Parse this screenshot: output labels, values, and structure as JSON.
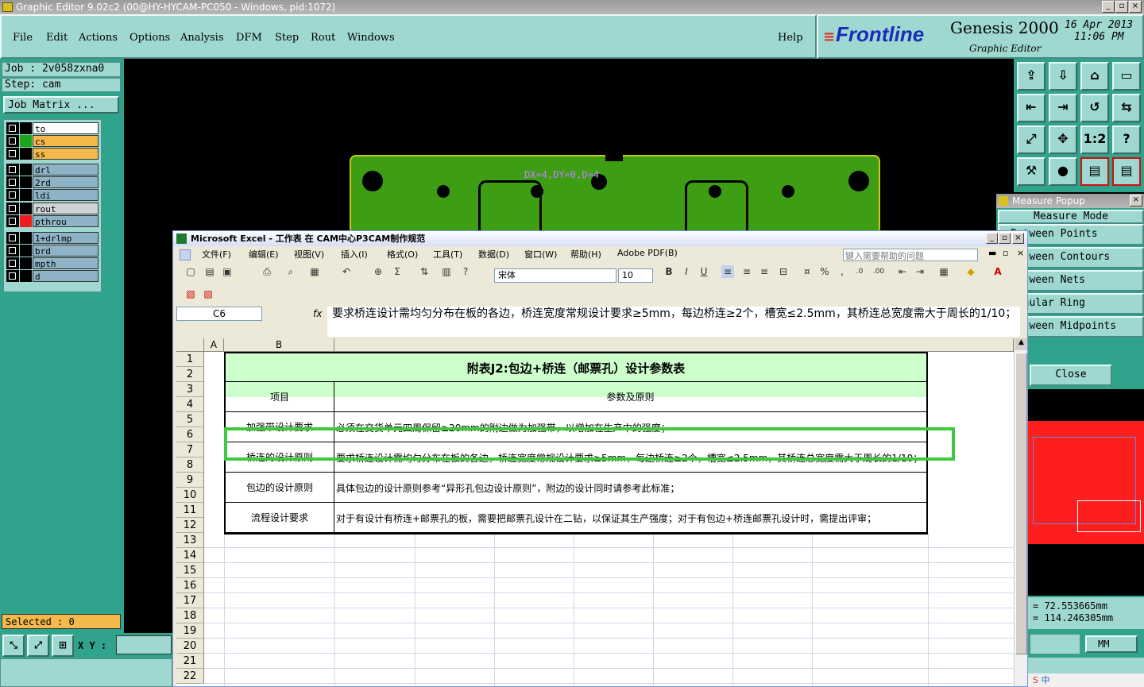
{
  "window": {
    "title": "Graphic Editor 9.02c2 (00@HY-HYCAM-PC050 - Windows, pid:1072)"
  },
  "genesis_menu": [
    "File",
    "Edit",
    "Actions",
    "Options",
    "Analysis",
    "DFM",
    "Step",
    "Rout",
    "Windows"
  ],
  "help": "Help",
  "logo": {
    "brand": "Frontline",
    "product": "Genesis 2000",
    "subtitle": "Graphic Editor",
    "date": "16 Apr 2013",
    "time": "11:06 PM"
  },
  "job": {
    "job": "Job : 2v058zxna0",
    "step": "Step: cam",
    "matrix": "Job Matrix ..."
  },
  "layers": [
    {
      "name": "to",
      "swatch": "#000000",
      "bg": "#ffffff"
    },
    {
      "name": "cs",
      "swatch": "#1aa51a",
      "bg": "#f4b94a"
    },
    {
      "name": "ss",
      "swatch": "#000000",
      "bg": "#f4b94a"
    },
    {
      "name": "drl",
      "swatch": "#000000",
      "bg": "#8fb3c6"
    },
    {
      "name": "2rd",
      "swatch": "#000000",
      "bg": "#8fb3c6"
    },
    {
      "name": "ldi",
      "swatch": "#000000",
      "bg": "#8fb3c6"
    },
    {
      "name": "rout",
      "swatch": "#000000",
      "bg": "#cfd3d3"
    },
    {
      "name": "pthrou",
      "swatch": "#ee1c1c",
      "bg": "#8fb3c6"
    },
    {
      "name": "1+drlmp",
      "swatch": "#000000",
      "bg": "#8fb3c6"
    },
    {
      "name": "brd",
      "swatch": "#000000",
      "bg": "#8fb3c6"
    },
    {
      "name": "mpth",
      "swatch": "#000000",
      "bg": "#8fb3c6"
    },
    {
      "name": "d",
      "swatch": "#000000",
      "bg": "#8fb3c6"
    }
  ],
  "selected": "Selected : 0",
  "xy_label": "X Y :",
  "measure_label": "DX=4,DY=0,D=4",
  "measure_popup": {
    "title": "Measure Popup",
    "mode": "Measure Mode",
    "items": [
      "Between Points",
      "Between Contours",
      "Between Nets",
      "Annular Ring",
      "Between Midpoints"
    ],
    "close": "Close",
    "x": "= 72.553665mm",
    "y": "= 114.246305mm",
    "unit": "MM"
  },
  "icon_buttons": [
    "upload-icon",
    "download-icon",
    "home-icon",
    "window-icon",
    "left-arrow-icon",
    "right-arrow-icon",
    "rotate-icon",
    "mirror-icon",
    "expand-icon",
    "center-icon",
    "scale-12-icon",
    "help-icon",
    "tools-icon",
    "drill-icon",
    "layers-icon",
    "layers-red-icon"
  ],
  "excel": {
    "title": "Microsoft Excel - 工作表 在 CAM中心P3CAM制作规范",
    "menu": [
      "文件(F)",
      "编辑(E)",
      "视图(V)",
      "插入(I)",
      "格式(O)",
      "工具(T)",
      "数据(D)",
      "窗口(W)",
      "帮助(H)",
      "Adobe PDF(B)"
    ],
    "help_placeholder": "键入需要帮助的问题",
    "font": "宋体",
    "size": "10",
    "namebox": "C6",
    "fx": "fx",
    "formula": "要求桥连设计需均匀分布在板的各边，桥连宽度常规设计要求≥5mm，每边桥连≥2个，槽宽≤2.5mm，其桥连总宽度需大于周长的1/10；",
    "col_a": "A",
    "col_b": "B",
    "rows": [
      "1",
      "2",
      "3",
      "4",
      "5",
      "6",
      "7",
      "8",
      "9",
      "10",
      "11",
      "12",
      "13",
      "14",
      "15",
      "16",
      "17",
      "18",
      "19",
      "20",
      "21",
      "22"
    ],
    "table_title": "附表J2:包边+桥连（邮票孔）设计参数表",
    "col1": "项目",
    "col2": "参数及原则",
    "data": [
      {
        "item": "加强带设计要求",
        "desc": "必须在交货单元四周保留≥20mm的附边做为加强带，以增加在生产中的强度；"
      },
      {
        "item": "桥连的设计原则",
        "desc": "要求桥连设计需均匀分布在板的各边，桥连宽度常规设计要求≥5mm，每边桥连≥2个，槽宽≤2.5mm，其桥连总宽度需大于周长的1/10；"
      },
      {
        "item": "包边的设计原则",
        "desc": "具体包边的设计原则参考“异形孔包边设计原则”，附边的设计同时请参考此标准；"
      },
      {
        "item": "流程设计要求",
        "desc": "对于有设计有桥连+邮票孔的板，需要把邮票孔设计在二钻，以保证其生产强度；对于有包边+桥连邮票孔设计时，需提出评审；"
      }
    ]
  },
  "taskbar": "中"
}
